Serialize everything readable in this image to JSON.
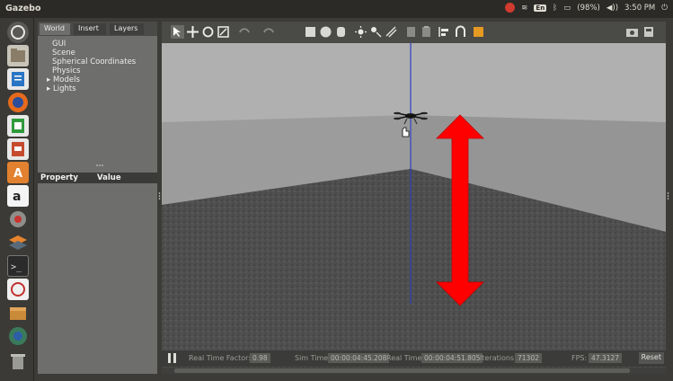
{
  "window": {
    "title": "Gazebo"
  },
  "system_tray": {
    "keyboard": "En",
    "battery": "(98%)",
    "time": "3:50 PM"
  },
  "launcher": {
    "icons": [
      "dash-icon",
      "files-icon",
      "writer-icon",
      "firefox-icon",
      "calc-icon",
      "impress-icon",
      "software-center-icon",
      "amazon-icon",
      "settings-icon",
      "layers-app-icon",
      "terminal-icon",
      "editor-icon",
      "box-icon",
      "globe-icon",
      "trash-icon"
    ]
  },
  "left_panel": {
    "tabs": [
      "World",
      "Insert",
      "Layers"
    ],
    "active_tab": "World",
    "tree": {
      "items": [
        "GUI",
        "Scene",
        "Spherical Coordinates",
        "Physics"
      ],
      "expandable": [
        "Models",
        "Lights"
      ]
    },
    "property_header": {
      "property": "Property",
      "value": "Value"
    }
  },
  "toolbar": {
    "tools": [
      "select-icon",
      "translate-icon",
      "rotate-icon",
      "scale-icon",
      "undo-icon",
      "redo-icon",
      "box-shape-icon",
      "sphere-shape-icon",
      "cylinder-shape-icon",
      "point-light-icon",
      "spot-light-icon",
      "directional-light-icon",
      "copy-icon",
      "paste-icon",
      "align-icon",
      "snap-icon",
      "change-view-icon",
      "screenshot-icon",
      "record-icon"
    ]
  },
  "status": {
    "real_time_factor_label": "Real Time Factor:",
    "real_time_factor": "0.98",
    "sim_time_label": "Sim Time:",
    "sim_time": "00:00:04:45.208",
    "real_time_label": "Real Time:",
    "real_time": "00:00:04:51.805",
    "iterations_label": "Iterations:",
    "iterations": "71302",
    "fps_label": "FPS:",
    "fps": "47.3127",
    "reset_label": "Reset"
  },
  "colors": {
    "arrow": "#ff0000",
    "z_axis": "#3040c0",
    "floor": "#4e4e4e",
    "walls": "#9a9a9a",
    "sky": "#b0b0b0"
  }
}
